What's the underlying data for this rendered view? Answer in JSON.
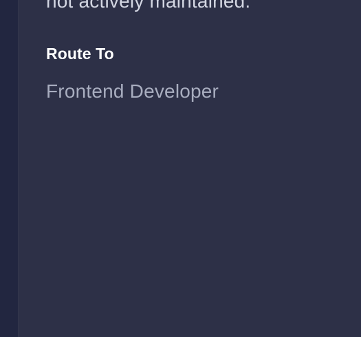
{
  "panel": {
    "truncated_description": "not actively maintained.",
    "route_to": {
      "label": "Route To",
      "value": "Frontend Developer"
    }
  },
  "colors": {
    "rail": "#222640",
    "panel_background": "#2d3047",
    "label_text": "#ffffff",
    "value_text": "#a8adbf",
    "description_text": "#d3d6e2"
  }
}
